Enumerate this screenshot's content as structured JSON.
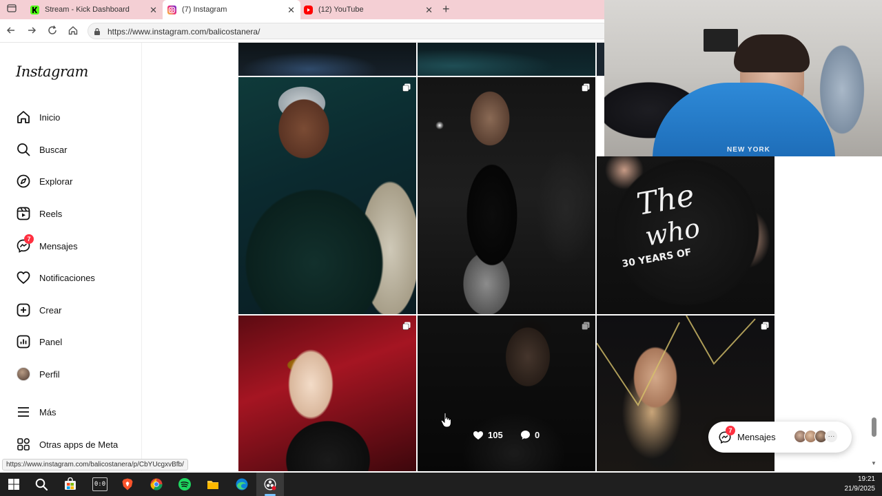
{
  "browser": {
    "tabs": [
      {
        "title": "Stream - Kick Dashboard",
        "icon": "kick-icon",
        "active": false
      },
      {
        "title": "(7) Instagram",
        "icon": "instagram-icon",
        "active": true
      },
      {
        "title": "(12) YouTube",
        "icon": "youtube-icon",
        "active": false
      }
    ],
    "close_glyph": "✕",
    "new_tab_glyph": "+",
    "url": "https://www.instagram.com/balicostanera/",
    "status_url": "https://www.instagram.com/balicostanera/p/CbYUcgxvBfb/"
  },
  "sidebar": {
    "logo": "Instagram",
    "items": [
      {
        "label": "Inicio",
        "icon": "home-icon"
      },
      {
        "label": "Buscar",
        "icon": "search-icon"
      },
      {
        "label": "Explorar",
        "icon": "compass-icon"
      },
      {
        "label": "Reels",
        "icon": "reels-icon"
      },
      {
        "label": "Mensajes",
        "icon": "messenger-icon",
        "badge": "7"
      },
      {
        "label": "Notificaciones",
        "icon": "heart-icon"
      },
      {
        "label": "Crear",
        "icon": "plus-square-icon"
      },
      {
        "label": "Panel",
        "icon": "bar-chart-icon"
      },
      {
        "label": "Perfil",
        "icon": "profile-avatar"
      },
      {
        "label": "Más",
        "icon": "menu-icon"
      },
      {
        "label": "Otras apps de Meta",
        "icon": "meta-apps-icon"
      }
    ]
  },
  "grid": {
    "hover_post": {
      "likes": "105",
      "comments": "0"
    }
  },
  "webcam_overlay": {
    "hoodie_text": "NEW YORK",
    "shirt_lines": [
      "The",
      "who",
      "30 YEARS OF"
    ]
  },
  "messages_pill": {
    "label": "Mensajes",
    "badge": "7",
    "more_glyph": "···"
  },
  "taskbar": {
    "time": "19:21",
    "date": "21/9/2025",
    "apps": [
      "windows-start-icon",
      "search-icon",
      "store-icon",
      "clock-app-icon",
      "brave-icon",
      "chrome-icon",
      "spotify-icon",
      "file-explorer-icon",
      "edge-icon",
      "obs-icon"
    ],
    "clock_app_glyph": "0:0"
  },
  "colors": {
    "tab_strip": "#f4cfd4",
    "badge_red": "#ff3040",
    "taskbar": "#1f1f1f"
  }
}
